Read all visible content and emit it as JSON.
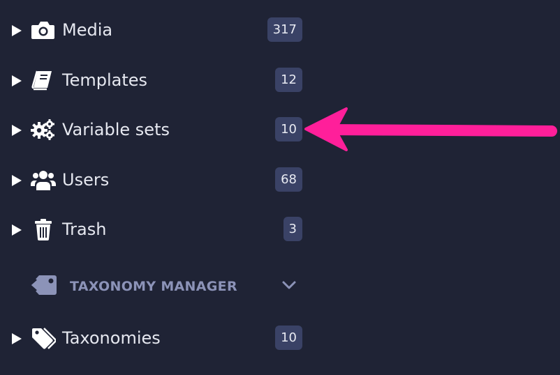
{
  "nav": {
    "items": [
      {
        "label": "Media",
        "count": "317",
        "icon": "camera-icon"
      },
      {
        "label": "Templates",
        "count": "12",
        "icon": "book-icon"
      },
      {
        "label": "Variable sets",
        "count": "10",
        "icon": "gears-icon"
      },
      {
        "label": "Users",
        "count": "68",
        "icon": "users-icon"
      },
      {
        "label": "Trash",
        "count": "3",
        "icon": "trash-icon"
      }
    ],
    "section": {
      "title": "TAXONOMY MANAGER",
      "icon": "tag-icon",
      "toggle_icon": "chevron-down-icon"
    },
    "section_items": [
      {
        "label": "Taxonomies",
        "count": "10",
        "icon": "tags-icon"
      }
    ]
  },
  "annotation": {
    "color": "#ff1f9a",
    "points_to": "Variable sets"
  },
  "colors": {
    "background": "#1f2335",
    "badge": "#3a4266",
    "section_title": "#8c93b8"
  }
}
